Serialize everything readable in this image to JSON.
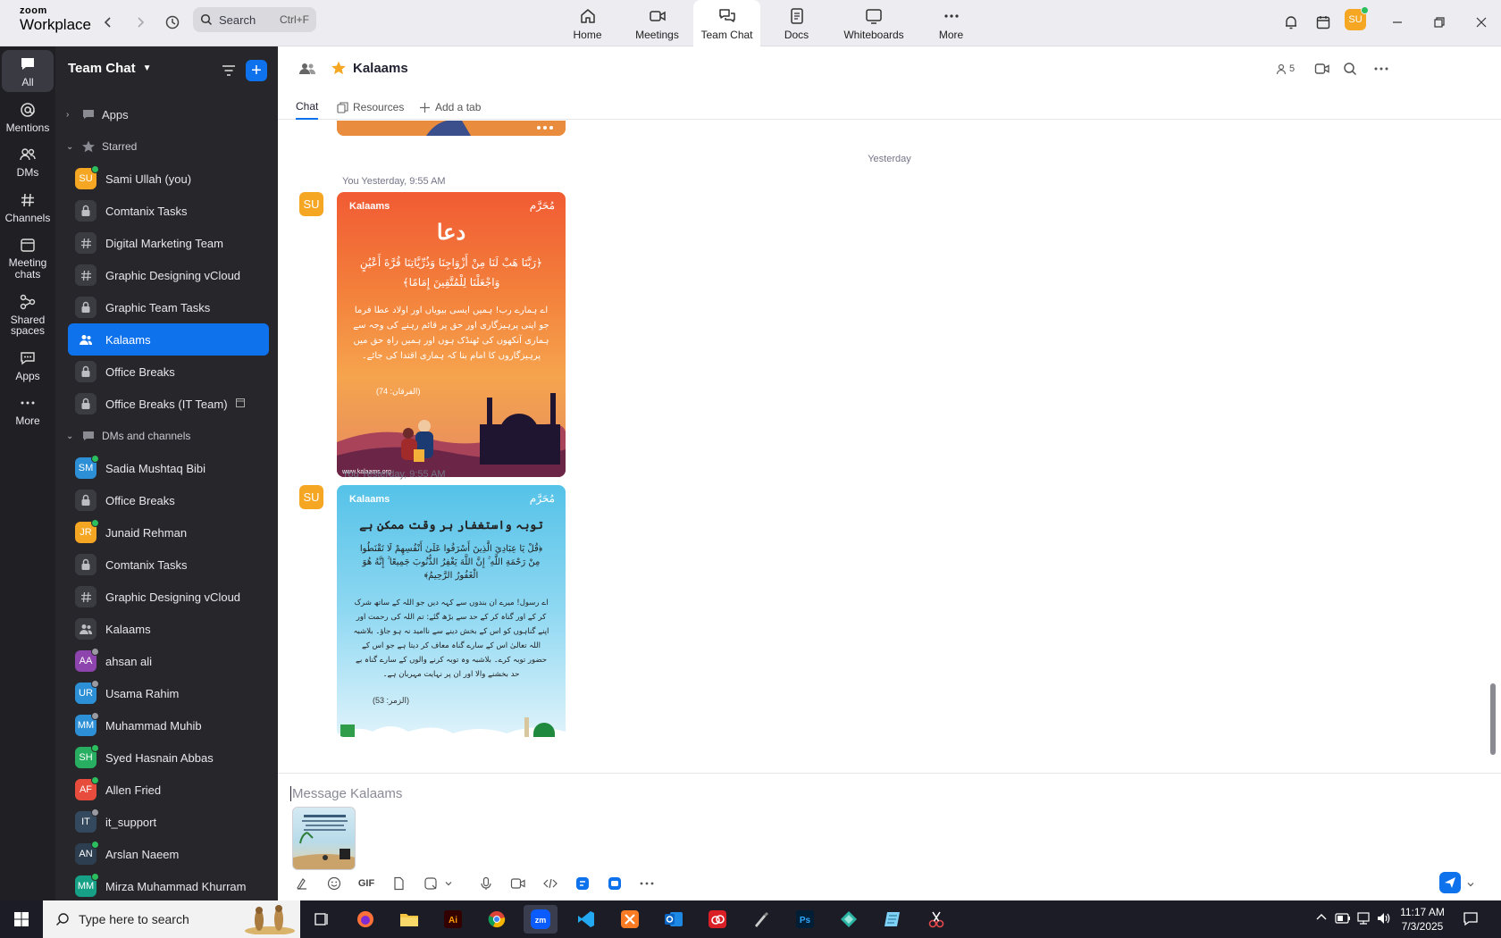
{
  "app": {
    "logo_line1": "zoom",
    "logo_line2": "Workplace"
  },
  "topbar": {
    "search_label": "Search",
    "search_shortcut": "Ctrl+F",
    "tabs": [
      {
        "label": "Home",
        "icon": "home-icon"
      },
      {
        "label": "Meetings",
        "icon": "video-camera-icon"
      },
      {
        "label": "Team Chat",
        "icon": "chat-bubbles-icon",
        "active": true
      },
      {
        "label": "Docs",
        "icon": "document-icon"
      },
      {
        "label": "Whiteboards",
        "icon": "whiteboard-icon"
      },
      {
        "label": "More",
        "icon": "more-dots-icon"
      }
    ],
    "user_initials": "SU"
  },
  "rail": [
    {
      "label": "All",
      "icon": "chat-icon",
      "active": true
    },
    {
      "label": "Mentions",
      "icon": "at-icon"
    },
    {
      "label": "DMs",
      "icon": "people-icon"
    },
    {
      "label": "Channels",
      "icon": "hash-icon"
    },
    {
      "label": "Meeting chats",
      "icon": "calendar-icon"
    },
    {
      "label": "Shared spaces",
      "icon": "shared-spaces-icon"
    },
    {
      "label": "Apps",
      "icon": "apps-icon"
    },
    {
      "label": "More",
      "icon": "more-dots-icon"
    }
  ],
  "sidebar": {
    "title": "Team Chat",
    "sections": {
      "apps": "Apps",
      "starred": "Starred",
      "dms": "DMs and channels"
    },
    "starred": [
      {
        "name": "Sami Ullah (you)",
        "type": "avatar",
        "initials": "SU",
        "color": "#f5a623",
        "presence": "#2bbf5d"
      },
      {
        "name": "Comtanix Tasks",
        "type": "lock"
      },
      {
        "name": "Digital Marketing Team",
        "type": "hash"
      },
      {
        "name": "Graphic Designing vCloud",
        "type": "hash"
      },
      {
        "name": "Graphic Team Tasks",
        "type": "lock"
      },
      {
        "name": "Kalaams",
        "type": "group",
        "active": true
      },
      {
        "name": "Office Breaks",
        "type": "lock"
      },
      {
        "name": "Office Breaks (IT Team)",
        "type": "lock",
        "archived": true
      }
    ],
    "dms": [
      {
        "name": "Sadia Mushtaq Bibi",
        "type": "avatar",
        "initials": "SM",
        "color": "#2d8fd5",
        "presence": "#2bbf5d"
      },
      {
        "name": "Office Breaks",
        "type": "lock"
      },
      {
        "name": "Junaid Rehman",
        "type": "avatar",
        "initials": "JR",
        "color": "#f5a623",
        "presence": "#2bbf5d"
      },
      {
        "name": "Comtanix Tasks",
        "type": "lock"
      },
      {
        "name": "Graphic Designing vCloud",
        "type": "hash"
      },
      {
        "name": "Kalaams",
        "type": "group"
      },
      {
        "name": "ahsan ali",
        "type": "avatar",
        "initials": "AA",
        "color": "#8e44ad",
        "presence": "#9a9aa2"
      },
      {
        "name": "Usama Rahim",
        "type": "avatar",
        "initials": "UR",
        "color": "#2d8fd5",
        "presence": "#9a9aa2"
      },
      {
        "name": "Muhammad Muhib",
        "type": "avatar",
        "initials": "MM",
        "color": "#2d8fd5",
        "presence": "#9a9aa2"
      },
      {
        "name": "Syed Hasnain Abbas",
        "type": "avatar",
        "initials": "SH",
        "color": "#27ae60",
        "presence": "#2bbf5d"
      },
      {
        "name": "Allen Fried",
        "type": "avatar",
        "initials": "AF",
        "color": "#e74c3c",
        "presence": "#2bbf5d"
      },
      {
        "name": "it_support",
        "type": "avatar",
        "initials": "IT",
        "color": "#34495e",
        "presence": "#9a9aa2"
      },
      {
        "name": "Arslan Naeem",
        "type": "avatar",
        "initials": "AN",
        "color": "#2c3e50",
        "presence": "#2bbf5d"
      },
      {
        "name": "Mirza Muhammad Khurram",
        "type": "avatar",
        "initials": "MM",
        "color": "#16a085",
        "presence": "#2bbf5d"
      }
    ]
  },
  "channel": {
    "name": "Kalaams",
    "member_count": "5",
    "tabs": {
      "chat": "Chat",
      "resources": "Resources",
      "add": "Add a tab"
    },
    "day_separator": "Yesterday",
    "messages": [
      {
        "meta": "You Yesterday, 9:55 AM",
        "avatar": "SU",
        "card": {
          "brand": "Kalaams",
          "brand_right": "مُحَرَّم",
          "title": "دعا",
          "arabic": "﴿رَبَّنَا هَبْ لَنَا مِنْ أَزْوَاجِنَا وَذُرِّيَّاتِنَا قُرَّةَ أَعْيُنٍ وَاجْعَلْنَا لِلْمُتَّقِينَ إِمَامًا﴾",
          "urdu": "اے ہمارے رب! ہمیں ایسی بیویاں اور اولاد عطا فرما جو اپنی پرہیزگاری اور حق پر قائم رہنے کی وجہ سے ہماری آنکھوں کی ٹھنڈک ہوں اور ہمیں راہِ حق میں پرہیزگاروں کا امام بنا کہ ہماری اقتدا کی جائے۔",
          "ref": "(الفرقان: 74)",
          "site": "www.kalaams.org"
        }
      },
      {
        "meta": "You Yesterday, 9:55 AM",
        "avatar": "SU",
        "card": {
          "brand": "Kalaams",
          "brand_right": "مُحَرَّم",
          "title": "توبہ واستغفار ہر وقت ممکن ہے",
          "arabic": "﴿قُلْ يَا عِبَادِيَ الَّذِينَ أَسْرَفُوا عَلَىٰ أَنْفُسِهِمْ لَا تَقْنَطُوا مِنْ رَحْمَةِ اللَّهِ ۚ إِنَّ اللَّهَ يَغْفِرُ الذُّنُوبَ جَمِيعًا ۚ إِنَّهُ هُوَ الْغَفُورُ الرَّحِيمُ﴾",
          "urdu": "اے رسول! میرے ان بندوں سے کہہ دیں جو اللہ کے ساتھ شرک کر کے اور گناہ کر کے حد سے بڑھ گئے: تم اللہ کی رحمت اور اپنے گناہوں کو اس کے بخش دینے سے ناامید نہ ہو جاؤ۔ بلاشبہ اللہ تعالیٰ اس کے سارے گناہ معاف کر دیتا ہے جو اس کے حضور توبہ کرے۔ بلاشبہ وہ توبہ کرنے والوں کے سارے گناہ بے حد بخشنے والا اور ان پر نہایت مہربان ہے۔",
          "ref": "(الزمر: 53)"
        }
      }
    ],
    "composer_placeholder": "Message Kalaams",
    "gif_label": "GIF"
  },
  "taskbar": {
    "search_placeholder": "Type here to search",
    "time": "11:17 AM",
    "date": "7/3/2025"
  }
}
